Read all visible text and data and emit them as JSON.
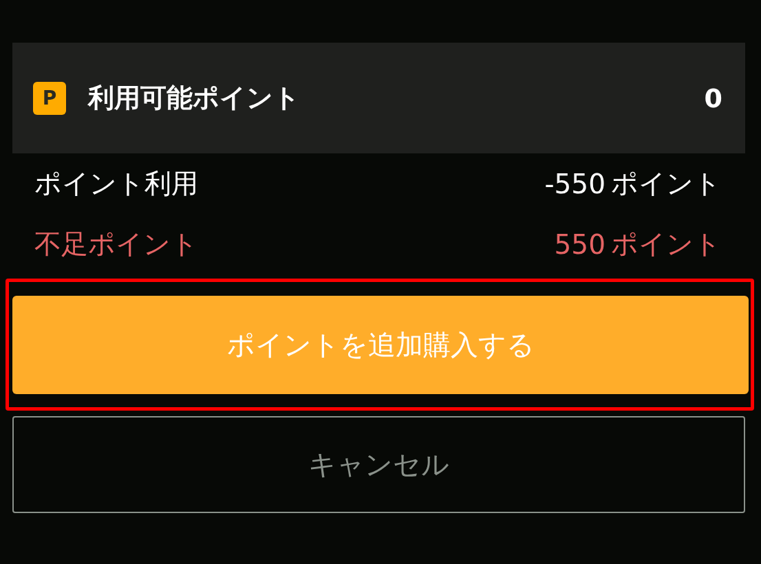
{
  "balance": {
    "icon_letter": "P",
    "label": "利用可能ポイント",
    "value": "0"
  },
  "rows": [
    {
      "kind": "normal",
      "label": "ポイント利用",
      "amount": "-550",
      "unit": "ポイント"
    },
    {
      "kind": "alert",
      "label": "不足ポイント",
      "amount": "550",
      "unit": "ポイント"
    }
  ],
  "buy_button": {
    "label": "ポイントを追加購入する",
    "highlighted": true
  },
  "cancel_button": {
    "label": "キャンセル"
  }
}
